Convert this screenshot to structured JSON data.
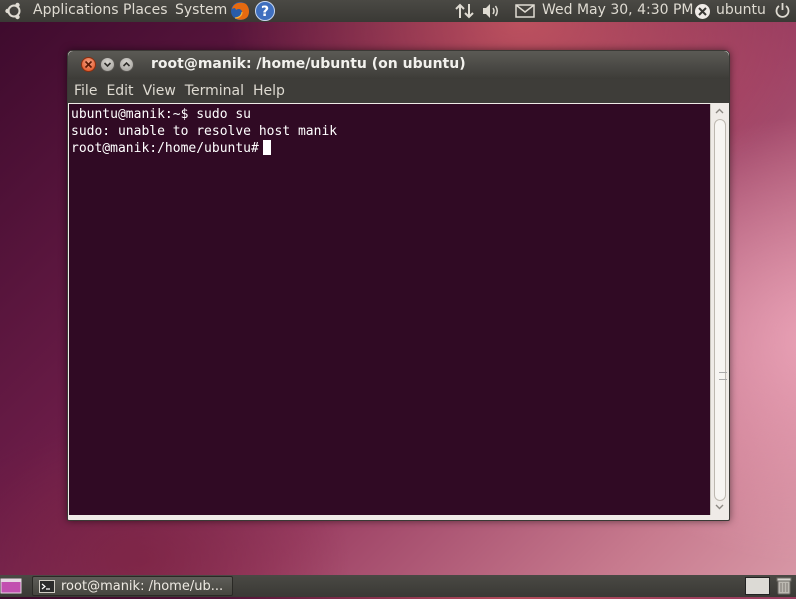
{
  "top_panel": {
    "menus": [
      "Applications",
      "Places",
      "System"
    ],
    "datetime": "Wed May 30,  4:30 PM",
    "user": "ubuntu",
    "icons": [
      "ubuntu-logo-icon",
      "firefox-icon",
      "help-icon",
      "network-icon",
      "volume-icon",
      "mail-icon",
      "user-status-icon",
      "power-icon"
    ]
  },
  "window": {
    "title": "root@manik: /home/ubuntu (on ubuntu)",
    "menu": [
      "File",
      "Edit",
      "View",
      "Terminal",
      "Help"
    ],
    "terminal_lines": [
      "ubuntu@manik:~$ sudo su",
      "sudo: unable to resolve host manik",
      "root@manik:/home/ubuntu#"
    ]
  },
  "bottom_panel": {
    "task_label": "root@manik: /home/ub..."
  },
  "colors": {
    "terminal_bg": "#300a24",
    "panel_bg": "#3c3b37",
    "close_button": "#df4a17"
  }
}
